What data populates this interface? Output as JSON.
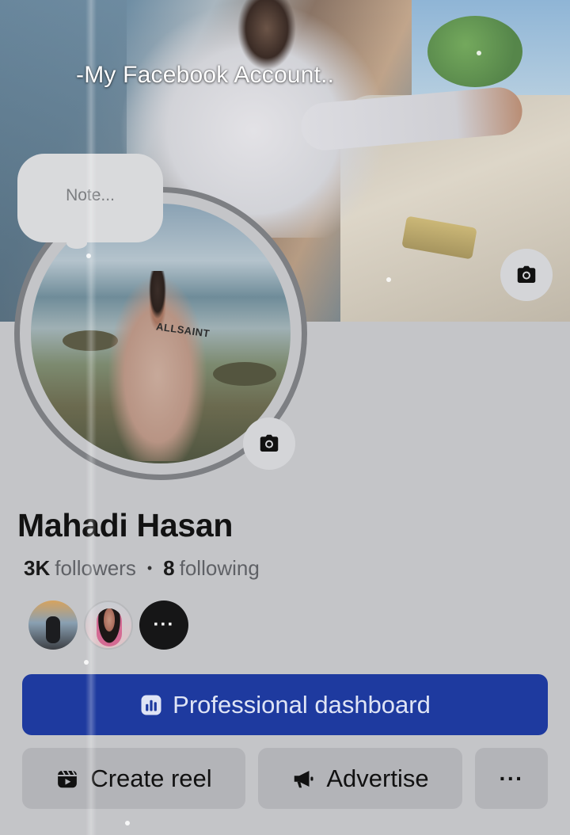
{
  "cover": {
    "title": "-My Facebook Account.."
  },
  "icons": {
    "cover_camera": "camera-icon",
    "avatar_camera": "camera-icon",
    "dashboard": "bar-chart-icon",
    "reel": "reel-icon",
    "advertise": "megaphone-icon"
  },
  "note": {
    "placeholder": "Note..."
  },
  "avatar": {
    "shirt_text": "ALLSAINT"
  },
  "profile": {
    "name": "Mahadi Hasan",
    "followers_count": "3K",
    "followers_label": "followers",
    "separator": "•",
    "following_count": "8",
    "following_label": "following"
  },
  "friends": {
    "more_label": "···"
  },
  "actions": {
    "professional_dashboard": "Professional dashboard",
    "create_reel": "Create reel",
    "advertise": "Advertise",
    "more": "···"
  },
  "colors": {
    "primary_button": "#1e3a9f",
    "secondary_button": "#b3b4b8",
    "page_background": "#c4c5c8"
  }
}
